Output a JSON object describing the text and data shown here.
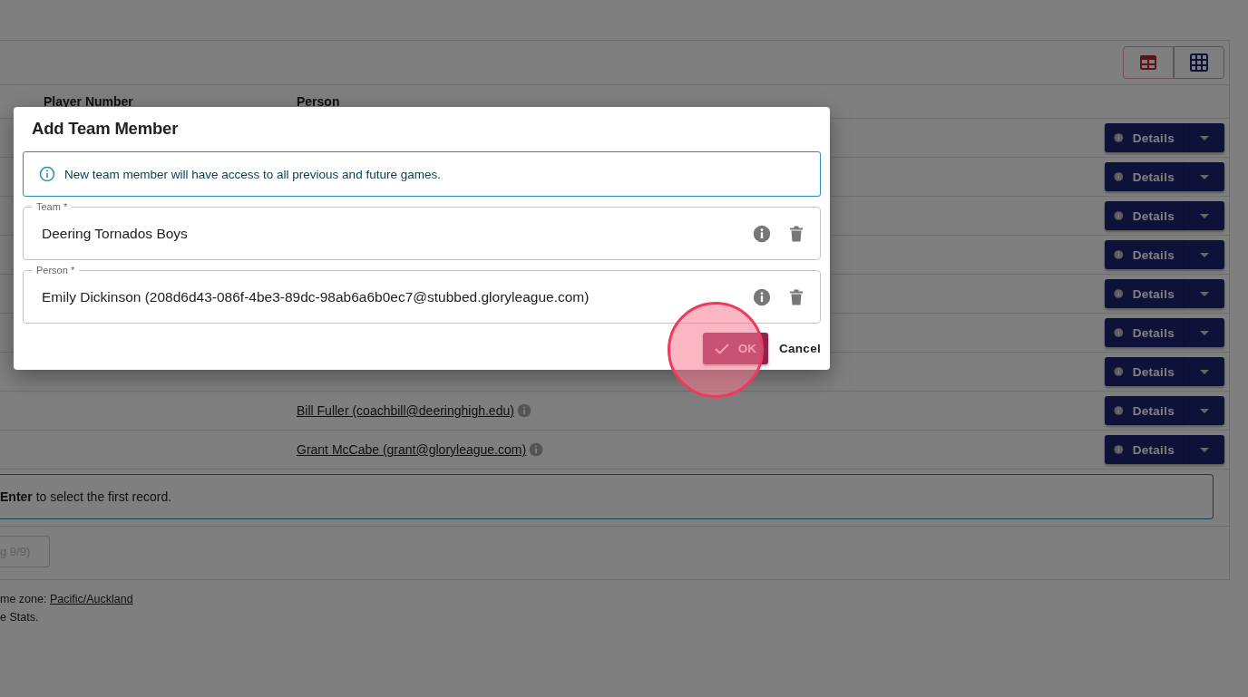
{
  "view_toggle": [
    {
      "kind": "table",
      "selected": true
    },
    {
      "kind": "grid",
      "selected": false
    }
  ],
  "table": {
    "columns": [
      "Player Number",
      "Person"
    ],
    "rows": [
      {
        "action": "Details"
      },
      {
        "action": "Details"
      },
      {
        "action": "Details"
      },
      {
        "action": "Details"
      },
      {
        "action": "Details"
      },
      {
        "action": "Details"
      },
      {
        "action": "Details"
      },
      {
        "person": "Bill Fuller (coachbill@deeringhigh.edu)",
        "action": "Details"
      },
      {
        "person": "Grant McCabe (grant@gloryleague.com)",
        "action": "Details"
      }
    ]
  },
  "search_hint": "**Enter** to select the first record.",
  "pager_button": "g 9/9)",
  "footer": {
    "time_zone_label": "me zone:",
    "time_zone": "Pacific/Auckland",
    "note": "e Stats."
  },
  "dialog": {
    "title": "Add Team Member",
    "alert": "New team member will have access to all previous and future games.",
    "fields": [
      {
        "label": "Team *",
        "value": "Deering Tornados Boys"
      },
      {
        "label": "Person *",
        "value": "Emily Dickinson (208d6d43-086f-4be3-89dc-98ab6a6b0ec7@stubbed.gloryleague.com)"
      }
    ],
    "ok": "OK",
    "cancel": "Cancel",
    "click_highlight": true
  }
}
